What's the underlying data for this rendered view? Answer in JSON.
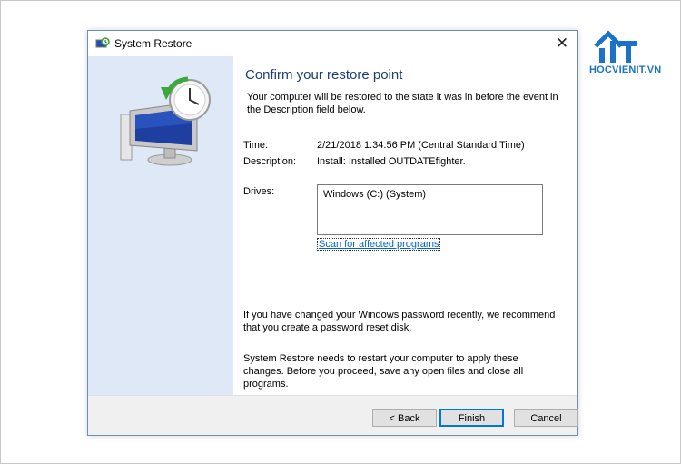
{
  "window": {
    "title": "System Restore",
    "close_glyph": "✕"
  },
  "content": {
    "heading": "Confirm your restore point",
    "intro": "Your computer will be restored to the state it was in before the event in the Description field below.",
    "time_label": "Time:",
    "time_value": "2/21/2018 1:34:56 PM (Central Standard Time)",
    "description_label": "Description:",
    "description_value": "Install: Installed OUTDATEfighter.",
    "drives_label": "Drives:",
    "drives": [
      "Windows (C:) (System)"
    ],
    "scan_link": "Scan for affected programs",
    "password_note": "If you have changed your Windows password recently, we recommend that you create a password reset disk.",
    "restart_note": "System Restore needs to restart your computer to apply these changes. Before you proceed, save any open files and close all programs."
  },
  "buttons": {
    "back": "< Back",
    "finish": "Finish",
    "cancel": "Cancel"
  },
  "watermark": {
    "text": "HOCVIENIT.VN",
    "color": "#1a73c9"
  },
  "colors": {
    "heading": "#1b3f76",
    "left_panel": "#dfe8f6",
    "link": "#0066cc",
    "accent": "#0078d7"
  },
  "icons": {
    "app": "system-restore-icon",
    "hero": "restore-monitor-clock-icon",
    "close": "close-icon"
  }
}
